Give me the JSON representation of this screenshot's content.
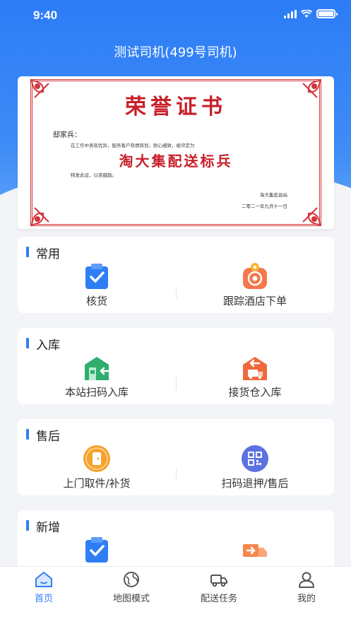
{
  "status_bar": {
    "time": "9:40"
  },
  "header": {
    "title": "测试司机(499号司机)"
  },
  "certificate": {
    "title": "荣誉证书",
    "recipient": "邸家兵：",
    "body": "在工作中表现优异，服务客户热情周到，耐心细致，被评定为",
    "honor": "淘大集配送标兵",
    "closing": "特发此证，以资鼓励。",
    "issuer": "淘大集宏昌站",
    "date": "二零二一年九月十一日"
  },
  "sections": [
    {
      "title": "常用",
      "items": [
        {
          "label": "核货",
          "icon": "clipboard-check-icon"
        },
        {
          "label": "跟踪酒店下单",
          "icon": "location-target-icon"
        }
      ]
    },
    {
      "title": "入库",
      "items": [
        {
          "label": "本站扫码入库",
          "icon": "warehouse-inbound-icon"
        },
        {
          "label": "接货仓入库",
          "icon": "warehouse-truck-icon"
        }
      ]
    },
    {
      "title": "售后",
      "items": [
        {
          "label": "上门取件/补货",
          "icon": "door-pickup-icon"
        },
        {
          "label": "扫码退押/售后",
          "icon": "qr-code-icon"
        }
      ]
    },
    {
      "title": "新增",
      "items": [
        {
          "label": "",
          "icon": "clipboard-check-icon"
        },
        {
          "label": "",
          "icon": "delivery-truck-icon"
        }
      ]
    }
  ],
  "tabbar": {
    "items": [
      {
        "label": "首页",
        "icon": "home-icon",
        "active": true
      },
      {
        "label": "地图模式",
        "icon": "globe-icon"
      },
      {
        "label": "配送任务",
        "icon": "truck-icon"
      },
      {
        "label": "我的",
        "icon": "user-icon"
      }
    ]
  },
  "colors": {
    "primary": "#2f7ef6",
    "orange": "#f58a28",
    "green": "#3fbf8a",
    "red": "#c8202a"
  }
}
